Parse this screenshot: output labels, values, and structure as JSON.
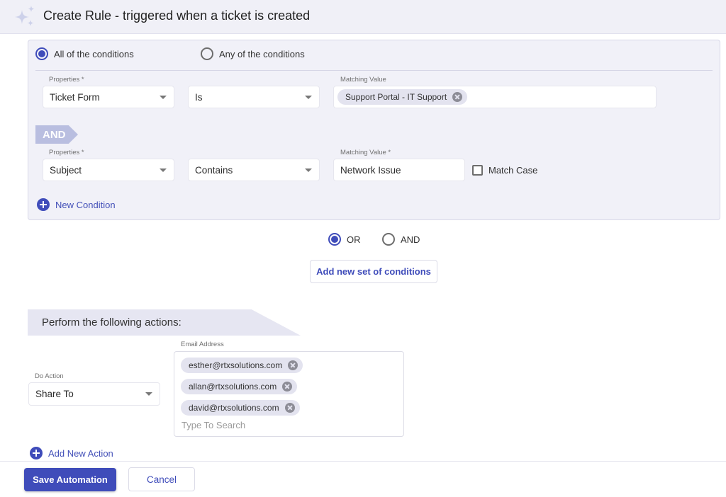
{
  "header": {
    "title": "Create Rule - triggered when a ticket is created",
    "icon": "sparkle-icon"
  },
  "conditions": {
    "match_mode": {
      "options": [
        "All of the conditions",
        "Any of the conditions"
      ],
      "selected": "All of the conditions"
    },
    "rows": [
      {
        "property_label": "Properties *",
        "property": "Ticket Form",
        "operator": "Is",
        "value_label": "Matching Value",
        "chips": [
          "Support Portal - IT Support"
        ]
      },
      {
        "property_label": "Properties *",
        "property": "Subject",
        "operator": "Contains",
        "value_label": "Matching Value *",
        "value": "Network Issue",
        "match_case_label": "Match Case",
        "match_case": false
      }
    ],
    "joiner": "AND",
    "new_condition_label": "New Condition"
  },
  "set_joiner": {
    "options": [
      "OR",
      "AND"
    ],
    "selected": "OR"
  },
  "add_set_label": "Add new set of conditions",
  "actions": {
    "banner": "Perform the following actions:",
    "do_action_label": "Do Action",
    "do_action": "Share To",
    "email_label": "Email Address",
    "emails": [
      "esther@rtxsolutions.com",
      "allan@rtxsolutions.com",
      "david@rtxsolutions.com"
    ],
    "email_placeholder": "Type To Search",
    "add_action_label": "Add New Action"
  },
  "footer": {
    "save_label": "Save Automation",
    "cancel_label": "Cancel"
  },
  "colors": {
    "accent": "#3f4cba",
    "panel_bg": "#f1f1f8",
    "and_tag": "#b9bee0"
  }
}
